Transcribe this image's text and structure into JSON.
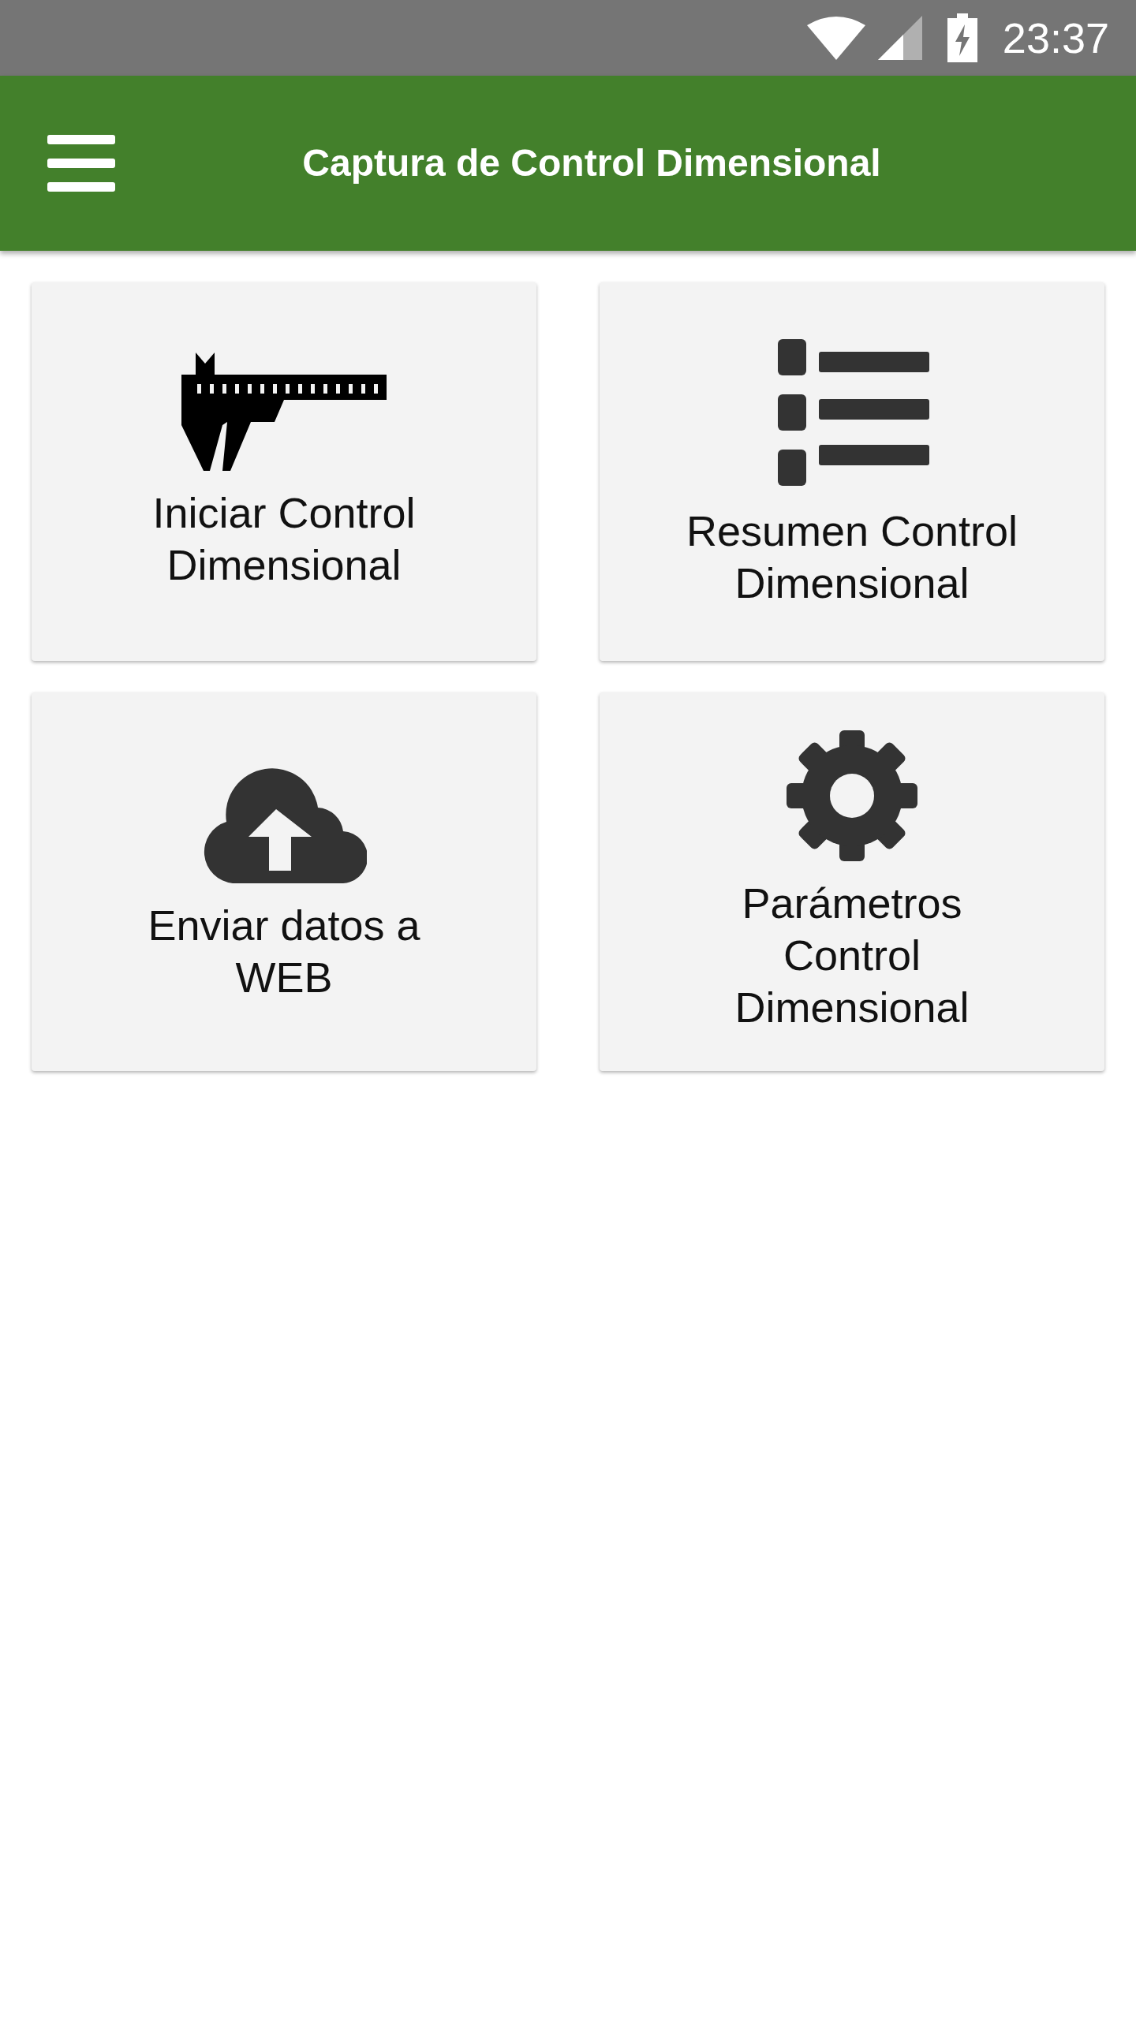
{
  "status_bar": {
    "time": "23:37"
  },
  "app_bar": {
    "title": "Captura de Control Dimensional"
  },
  "tiles": [
    {
      "kind": "caliper",
      "label": "Iniciar Control\nDimensional"
    },
    {
      "kind": "list",
      "label": "Resumen Control\nDimensional"
    },
    {
      "kind": "upload",
      "label": "Enviar datos a\nWEB"
    },
    {
      "kind": "settings",
      "label": "Parámetros\nControl\nDimensional"
    }
  ]
}
